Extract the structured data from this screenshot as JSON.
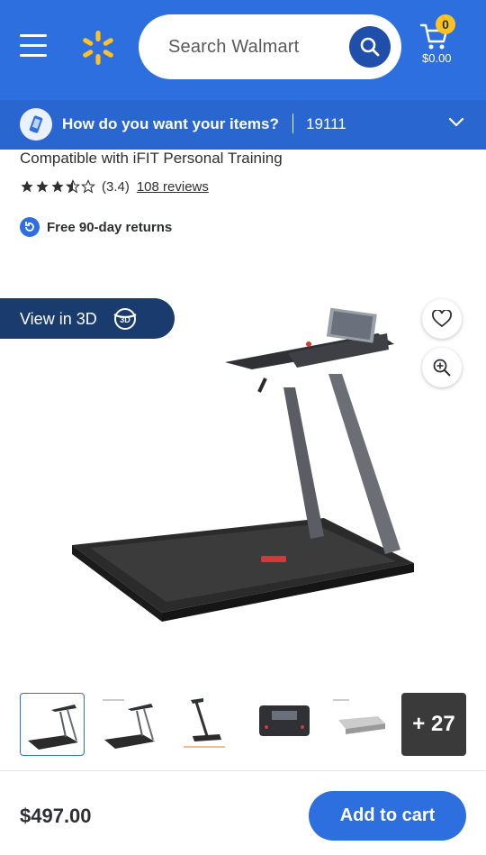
{
  "header": {
    "search_placeholder": "Search Walmart",
    "cart_count": "0",
    "cart_total": "$0.00",
    "brand_color": "#2e6fe0",
    "spark_color": "#ffc220"
  },
  "delivery": {
    "question": "How do you want your items?",
    "zip": "19111"
  },
  "product": {
    "compat_text": "Compatible with iFIT Personal Training",
    "rating_value": "(3.4)",
    "rating_stars": 3.4,
    "reviews_link": "108 reviews",
    "returns_text": "Free 90-day returns",
    "view3d_label": "View in 3D",
    "more_images_label": "+ 27",
    "price": "$497.00",
    "add_to_cart": "Add to cart"
  }
}
